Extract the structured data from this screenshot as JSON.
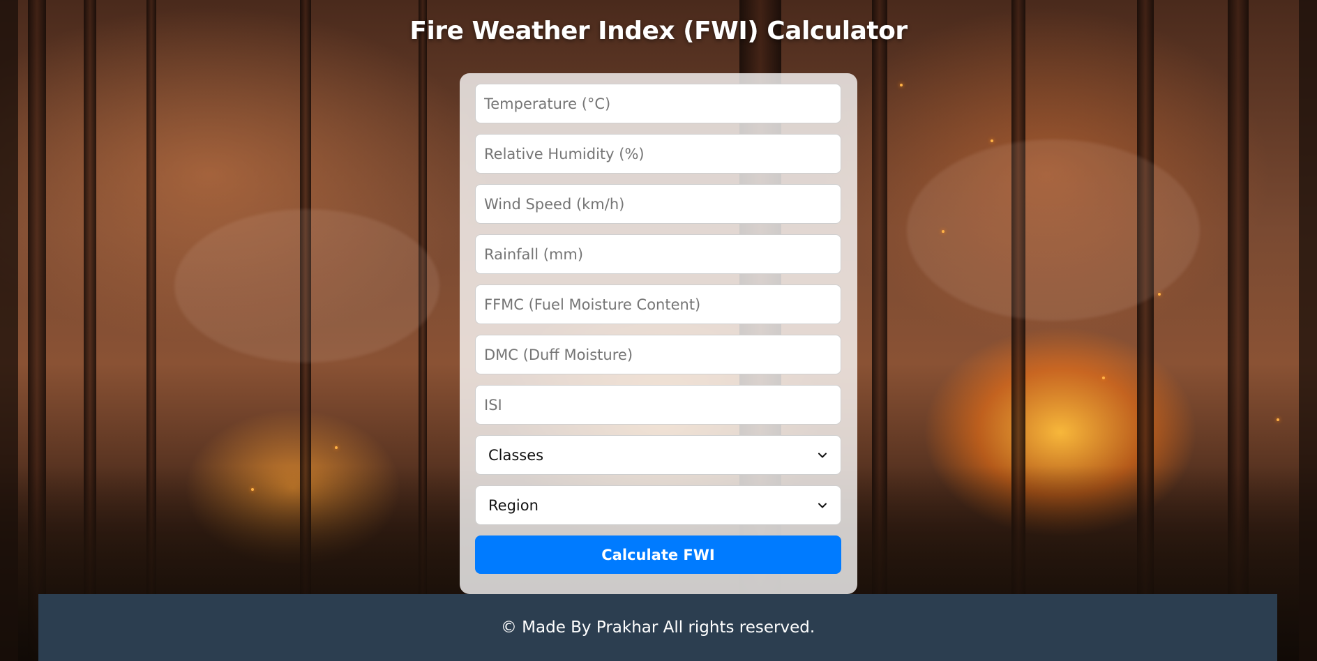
{
  "page": {
    "title": "Fire Weather Index (FWI) Calculator"
  },
  "form": {
    "temperature": {
      "placeholder": "Temperature (°C)",
      "value": ""
    },
    "humidity": {
      "placeholder": "Relative Humidity (%)",
      "value": ""
    },
    "wind_speed": {
      "placeholder": "Wind Speed (km/h)",
      "value": ""
    },
    "rainfall": {
      "placeholder": "Rainfall (mm)",
      "value": ""
    },
    "ffmc": {
      "placeholder": "FFMC (Fuel Moisture Content)",
      "value": ""
    },
    "dmc": {
      "placeholder": "DMC (Duff Moisture)",
      "value": ""
    },
    "isi": {
      "placeholder": "ISI",
      "value": ""
    },
    "classes": {
      "selected": "Classes",
      "icon": "chevron-down-icon"
    },
    "region": {
      "selected": "Region",
      "icon": "chevron-down-icon"
    },
    "submit_label": "Calculate FWI"
  },
  "footer": {
    "text": "© Made By Prakhar All rights reserved."
  },
  "colors": {
    "primary_button": "#007bff",
    "footer_background": "#2c3e50",
    "card_background": "rgba(255,255,255,0.78)",
    "title_text": "#ffffff"
  },
  "background": {
    "icon": "forest-fire-background"
  }
}
